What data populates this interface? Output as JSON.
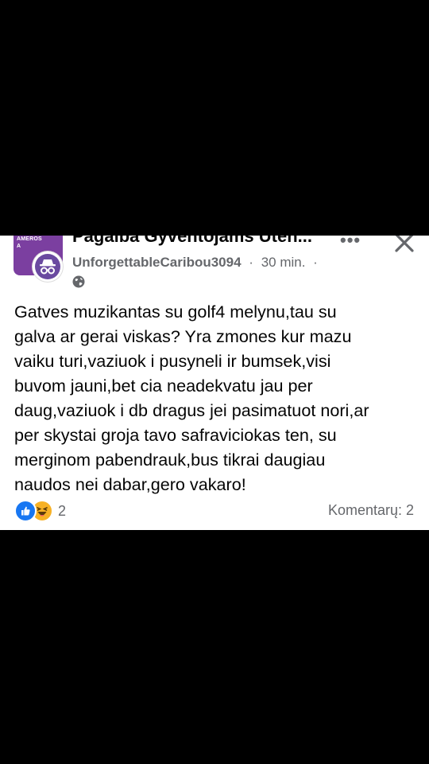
{
  "post": {
    "group_name": "Pagalba Gyventojams Uten...",
    "group_avatar_text": "AMEROS\nA",
    "author": "UnforgettableCaribou3094",
    "separator": "·",
    "time": "30 min.",
    "time_separator": "·",
    "more_label": "•••",
    "text": "Gatves muzikantas su golf4 melynu,tau su\ngalva ar gerai viskas? Yra zmones kur mazu\nvaiku turi,vaziuok i pusyneli ir bumsek,visi\nbuvom jauni,bet cia neadekvatu jau per\ndaug,vaziuok i db dragus jei pasimatuot nori,ar\nper skystai groja tavo safraviciokas ten, su\nmerginom pabendrauk,bus tikrai daugiau\nnaudos nei dabar,gero vakaro!",
    "reaction_count": "2",
    "comments": "Komentarų: 2",
    "icons": {
      "more": "more-dots-icon",
      "close": "close-icon",
      "privacy": "globe-icon",
      "avatar": "anonymous-incognito-icon",
      "reactions": [
        "like-icon",
        "haha-icon"
      ]
    },
    "colors": {
      "like": "#1877f2",
      "haha": "#f7b125",
      "group_avatar": "#7b3fa0",
      "meta_text": "#65676b"
    }
  }
}
